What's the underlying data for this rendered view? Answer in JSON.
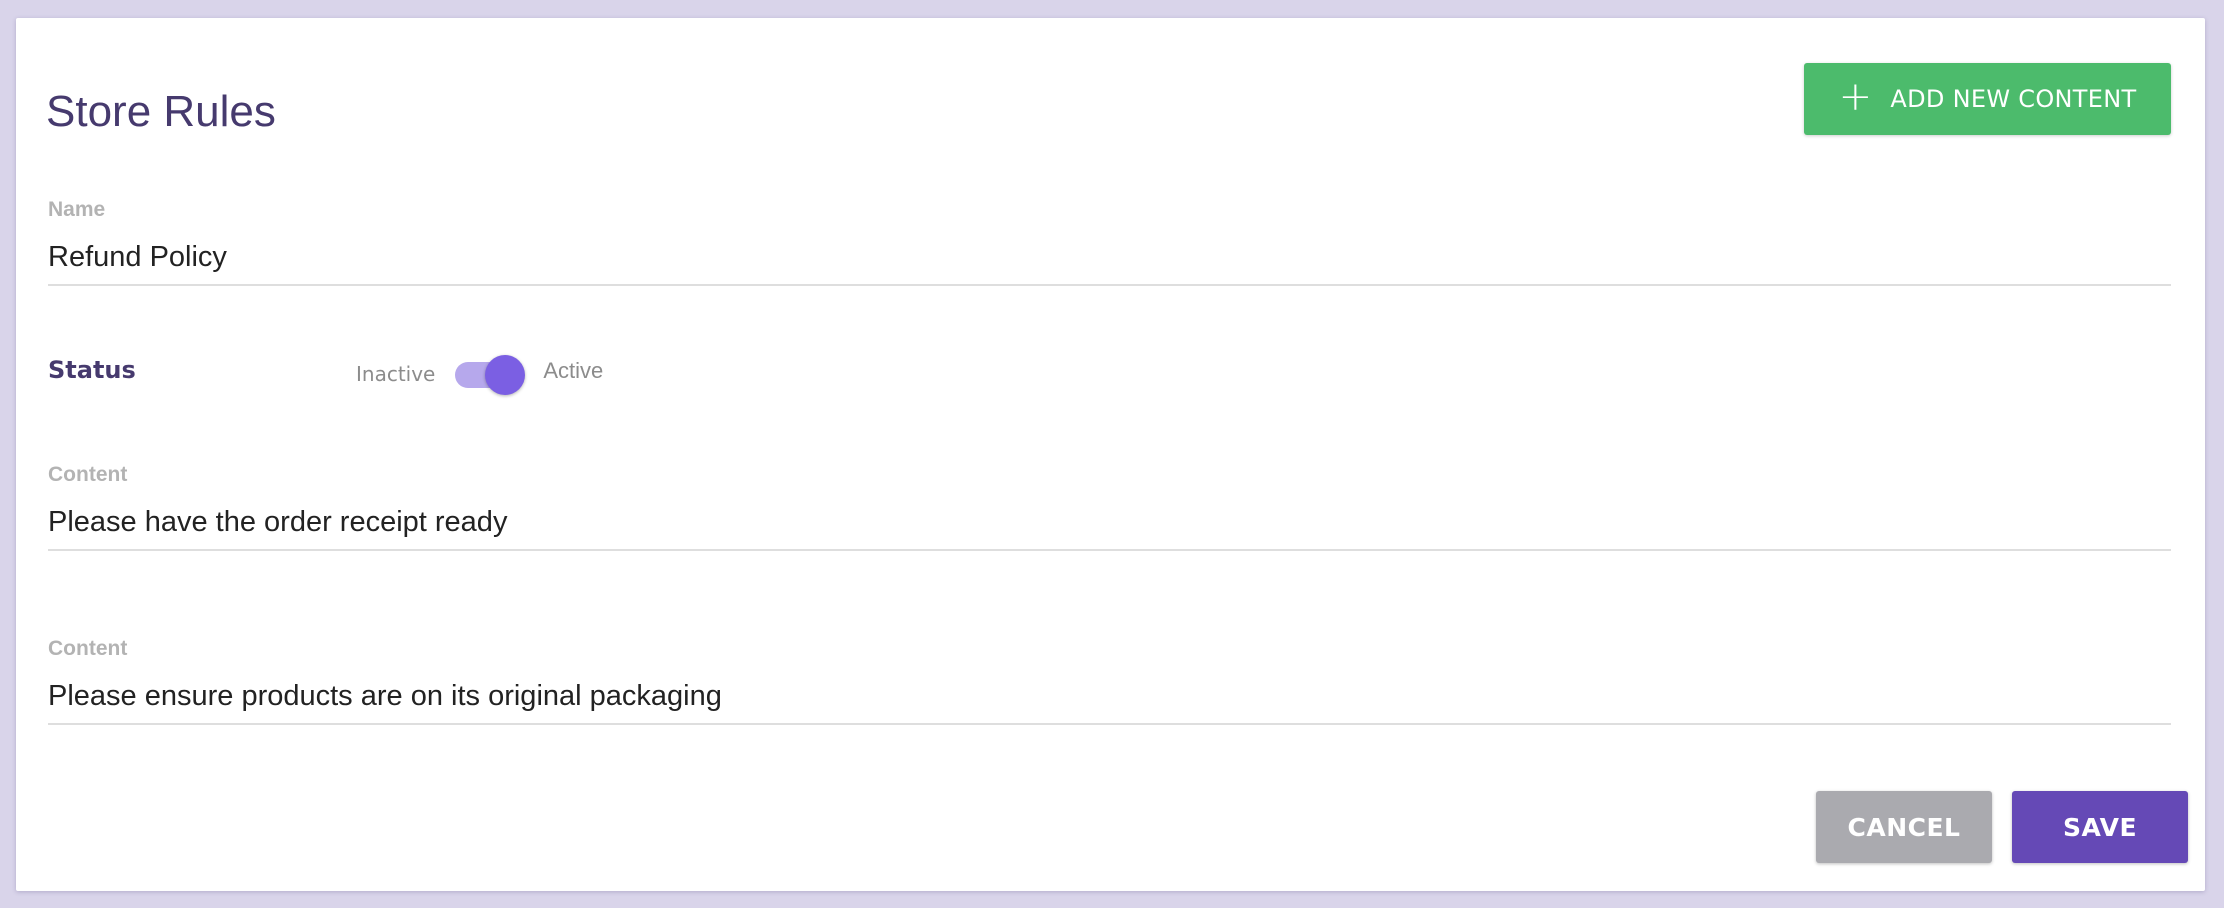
{
  "page": {
    "title": "Store Rules"
  },
  "header": {
    "add_button_icon": "plus-icon",
    "add_button_icon_glyph": "+",
    "add_button_label": "ADD NEW CONTENT"
  },
  "form": {
    "name": {
      "label": "Name",
      "value": "Refund Policy"
    },
    "status": {
      "label": "Status",
      "off_label": "Inactive",
      "on_label": "Active",
      "active": true
    },
    "contents": [
      {
        "label": "Content",
        "value": "Please have the order receipt ready"
      },
      {
        "label": "Content",
        "value": "Please ensure products are on its original packaging"
      }
    ]
  },
  "actions": {
    "cancel_label": "CANCEL",
    "save_label": "SAVE"
  },
  "colors": {
    "background": "#d9d4ea",
    "title": "#463a6e",
    "add_button": "#4cbb6c",
    "toggle_track": "#b6a8ec",
    "toggle_knob": "#7b5fe3",
    "cancel_button": "#aaaaaf",
    "save_button": "#6549b6"
  }
}
